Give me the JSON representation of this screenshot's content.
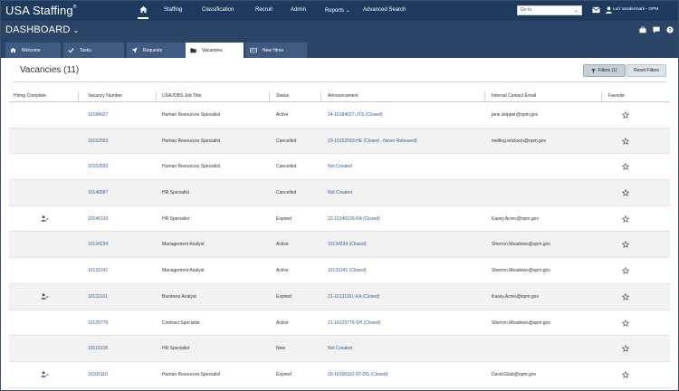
{
  "app": {
    "brand": "USA Staffing",
    "brand_mark": "®"
  },
  "nav": {
    "items": [
      "Staffing",
      "Classification",
      "Recruit",
      "Admin",
      "Reports",
      "Advanced Search"
    ],
    "search_placeholder": "Go to",
    "user": "Lori Vandermark - OPM"
  },
  "dashboard": {
    "title": "DASHBOARD",
    "tabs": [
      {
        "label": "Welcome"
      },
      {
        "label": "Tasks"
      },
      {
        "label": "Requests"
      },
      {
        "label": "Vacancies"
      },
      {
        "label": "New Hires"
      }
    ]
  },
  "main": {
    "title": "Vacancies (11)",
    "filters_label": "Filters (1)",
    "reset_label": "Reset Filters"
  },
  "table": {
    "headers": [
      "Hiring Complete",
      "Vacancy Number",
      "USAJOBS Job Title",
      "Status",
      "Announcement",
      "Internal Contact Email",
      "Favorite"
    ],
    "rows": [
      {
        "hired": false,
        "vacancy": "10184027",
        "title": "Human Resources Specialist",
        "status": "Active",
        "announcement": "24-10184027-JYS (Closed)",
        "email": "jane.skipper@opm.gov"
      },
      {
        "hired": false,
        "vacancy": "10152593",
        "title": "Human Resources Specialist",
        "status": "Cancelled",
        "announcement": "23-10152593-HE (Closed - Never Released)",
        "email": "melling.erickson@opm.gov"
      },
      {
        "hired": false,
        "vacancy": "10152592",
        "title": "Human Resources Specialist",
        "status": "Cancelled",
        "announcement": "Not Created",
        "email": ""
      },
      {
        "hired": false,
        "vacancy": "10146587",
        "title": "HR Specialist",
        "status": "Cancelled",
        "announcement": "Not Created",
        "email": ""
      },
      {
        "hired": true,
        "vacancy": "10146135",
        "title": "HR Specialist",
        "status": "Expired",
        "announcement": "22-10146135-KA (Closed)",
        "email": "Kasey.Acres@opm.gov"
      },
      {
        "hired": false,
        "vacancy": "10134234",
        "title": "Management Analyst",
        "status": "Active",
        "announcement": "10134234 (Closed)",
        "email": "Sherron.Meadows@opm.gov"
      },
      {
        "hired": false,
        "vacancy": "10131241",
        "title": "Management Analyst",
        "status": "Active",
        "announcement": "10131241 (Closed)",
        "email": "Sherron.Meadows@opm.gov"
      },
      {
        "hired": true,
        "vacancy": "10131161",
        "title": "Business Analyst",
        "status": "Expired",
        "announcement": "21-10131161-KA (Closed)",
        "email": "Kasey.Acres@opm.gov"
      },
      {
        "hired": false,
        "vacancy": "10125776",
        "title": "Contract Specialist",
        "status": "Active",
        "announcement": "21-10125776-SH (Closed)",
        "email": "Sherron.Meadows@opm.gov"
      },
      {
        "hired": false,
        "vacancy": "10119108",
        "title": "HR Specialist",
        "status": "New",
        "announcement": "Not Created",
        "email": ""
      },
      {
        "hired": true,
        "vacancy": "10100110",
        "title": "Human Resources Specialist",
        "status": "Expired",
        "announcement": "20-10100110-ST-DG (Closed)",
        "email": "David.Glatt@opm.gov"
      }
    ]
  },
  "colors": {
    "nav_bg": "#1f3a5f",
    "band_bg": "#2a4566",
    "tab_bg": "#3e5c82",
    "link": "#2f5d99"
  }
}
